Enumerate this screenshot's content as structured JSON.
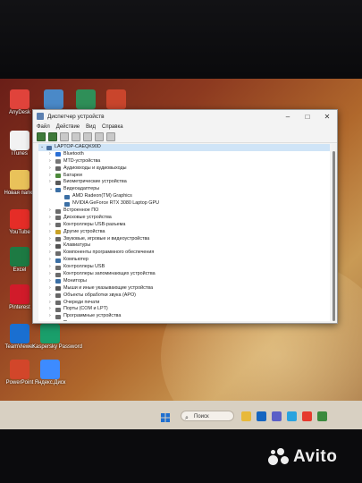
{
  "desktop": {
    "icons": [
      {
        "label": "AnyDesk",
        "color": "#e0433b"
      },
      {
        "label": "iTunes",
        "color": "#f2f2f2"
      },
      {
        "label": "Новая папка",
        "color": "#e9c25a"
      },
      {
        "label": "YouTube",
        "color": "#e52d27"
      },
      {
        "label": "Excel",
        "color": "#1d7a43"
      },
      {
        "label": "Pinterest",
        "color": "#d11b2a"
      },
      {
        "label": "TeamViewer",
        "color": "#1a6fd1"
      },
      {
        "label": "Kaspersky Password",
        "color": "#1a9f6b"
      },
      {
        "label": "PowerPoint",
        "color": "#d2462a"
      },
      {
        "label": "Яндекс.Диск",
        "color": "#3d8bff"
      },
      {
        "label": "",
        "color": "#4a89c8"
      },
      {
        "label": "",
        "color": "#2f8f58"
      },
      {
        "label": "",
        "color": "#c9452c"
      }
    ]
  },
  "window": {
    "title": "Диспетчер устройств",
    "menu": [
      "Файл",
      "Действие",
      "Вид",
      "Справка"
    ],
    "minimize": "–",
    "maximize": "□",
    "close": "✕",
    "tree": [
      {
        "label": "LAPTOP-CAEQK90D",
        "level": 0,
        "expanded": true,
        "icon": "#4a6f9e"
      },
      {
        "label": "Bluetooth",
        "level": 1,
        "icon": "#2a6fd6"
      },
      {
        "label": "MTD-устройства",
        "level": 1,
        "icon": "#777777"
      },
      {
        "label": "Аудиовходы и аудиовыходы",
        "level": 1,
        "icon": "#666666"
      },
      {
        "label": "Батареи",
        "level": 1,
        "icon": "#4c8a3a"
      },
      {
        "label": "Биометрические устройства",
        "level": 1,
        "icon": "#5a5a5a"
      },
      {
        "label": "Видеоадаптеры",
        "level": 1,
        "expanded": true,
        "icon": "#3b6fa5"
      },
      {
        "label": "AMD Radeon(TM) Graphics",
        "level": 2,
        "icon": "#3b6fa5"
      },
      {
        "label": "NVIDIA GeForce RTX 3080 Laptop GPU",
        "level": 2,
        "icon": "#3b6fa5"
      },
      {
        "label": "Встроенное ПО",
        "level": 1,
        "icon": "#6b6b6b"
      },
      {
        "label": "Дисковые устройства",
        "level": 1,
        "icon": "#6b6b6b"
      },
      {
        "label": "Контроллеры USB-разъема",
        "level": 1,
        "icon": "#6b6b6b"
      },
      {
        "label": "Другие устройства",
        "level": 1,
        "icon": "#c9a227"
      },
      {
        "label": "Звуковые, игровые и видеоустройства",
        "level": 1,
        "icon": "#666666"
      },
      {
        "label": "Клавиатуры",
        "level": 1,
        "icon": "#555555"
      },
      {
        "label": "Компоненты программного обеспечения",
        "level": 1,
        "icon": "#6b6b6b"
      },
      {
        "label": "Компьютер",
        "level": 1,
        "icon": "#3b6fa5"
      },
      {
        "label": "Контроллеры USB",
        "level": 1,
        "icon": "#6b6b6b"
      },
      {
        "label": "Контроллеры запоминающих устройства",
        "level": 1,
        "icon": "#6b6b6b"
      },
      {
        "label": "Мониторы",
        "level": 1,
        "icon": "#3b6fa5"
      },
      {
        "label": "Мыши и иные указывающие устройства",
        "level": 1,
        "icon": "#555555"
      },
      {
        "label": "Объекты обработки звука (APO)",
        "level": 1,
        "icon": "#666666"
      },
      {
        "label": "Очереди печати",
        "level": 1,
        "icon": "#6b6b6b"
      },
      {
        "label": "Порты (COM и LPT)",
        "level": 1,
        "icon": "#6b6b6b"
      },
      {
        "label": "Программные устройства",
        "level": 1,
        "icon": "#6b6b6b"
      },
      {
        "label": "Процессоры",
        "level": 1,
        "icon": "#6b6b6b"
      }
    ]
  },
  "taskbar": {
    "search_label": "Поиск",
    "icons": [
      {
        "name": "file-explorer-icon",
        "color": "#e8b93a"
      },
      {
        "name": "outlook-icon",
        "color": "#1565c0"
      },
      {
        "name": "teams-icon",
        "color": "#5b5fc7"
      },
      {
        "name": "telegram-icon",
        "color": "#2aa3df"
      },
      {
        "name": "yandex-browser-icon",
        "color": "#e63a2e"
      },
      {
        "name": "chrome-icon",
        "color": "#3b8a3e"
      }
    ]
  },
  "watermark": {
    "text": "Avito"
  }
}
